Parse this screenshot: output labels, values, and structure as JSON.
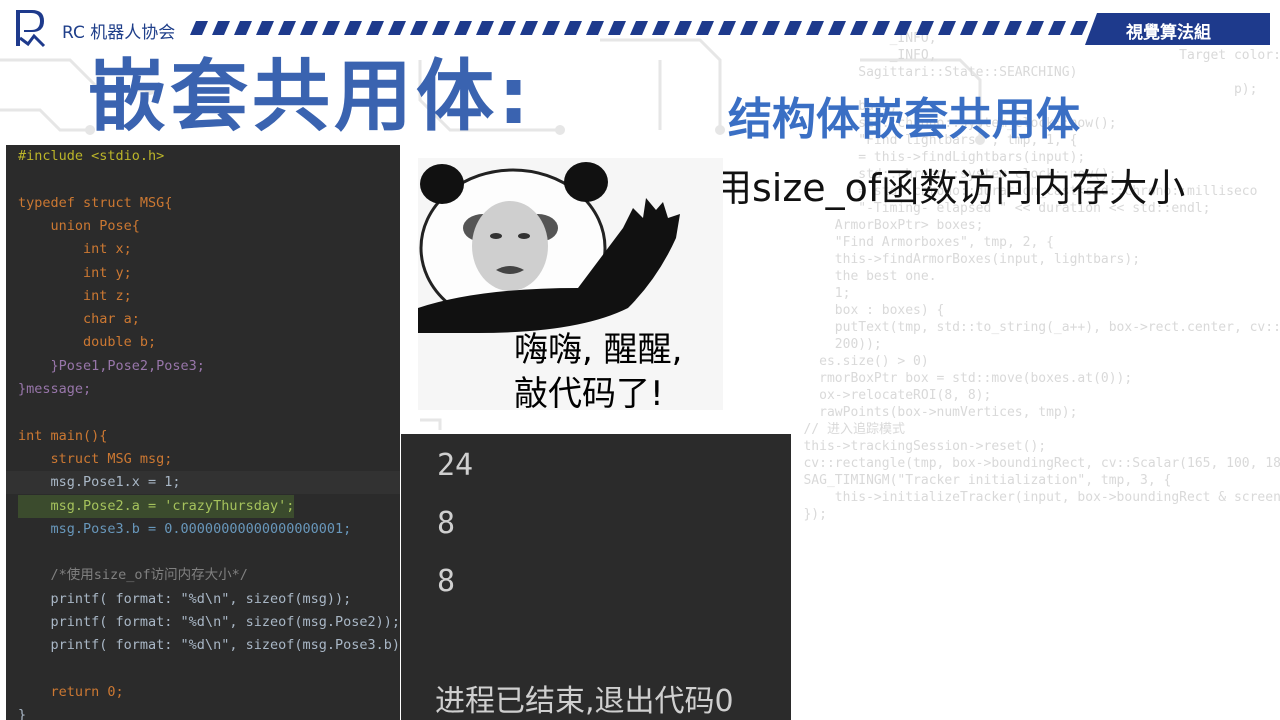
{
  "header": {
    "org_name": "RC 机器人协会",
    "team_label": "視覺算法組",
    "logo_icon": "rc-logo-icon",
    "accent": "#1e3a8c"
  },
  "slide": {
    "title": "嵌套共用体:",
    "subtitle": "结构体嵌套共用体",
    "description": "使用size_of函数访问内存大小"
  },
  "code": {
    "lines": [
      "#include <stdio.h>",
      "",
      "typedef struct MSG{",
      "    union Pose{",
      "        int x;",
      "        int y;",
      "        int z;",
      "        char a;",
      "        double b;",
      "    }Pose1,Pose2,Pose3;",
      "}message;",
      "",
      "int main(){",
      "    struct MSG msg;",
      "    msg.Pose1.x = 1;",
      "    msg.Pose2.a = 'crazyThursday';",
      "    msg.Pose3.b = 0.00000000000000000001;",
      "",
      "    /*使用size_of访问内存大小*/",
      "    printf( format: \"%d\\n\", sizeof(msg));",
      "    printf( format: \"%d\\n\", sizeof(msg.Pose2));",
      "    printf( format: \"%d\\n\", sizeof(msg.Pose3.b));",
      "",
      "    return 0;",
      "}"
    ]
  },
  "meme": {
    "line1": "嗨嗨, 醒醒,",
    "line2": "敲代码了!"
  },
  "output": {
    "values": [
      "24",
      "8",
      "8"
    ],
    "exit_message": "进程已结束,退出代码0"
  },
  "background_code": [
    "              _INFO,",
    "",
    "              _INFO,                               Target color:",
    "",
    "",
    "",
    "",
    "          Sagittari::State::SEARCHING)",
    "",
    "                                                          p);",
    "          bars;",
    "          std::chrono::system_clock::now();",
    "          \"Find lightbars \", tmp, 1, {",
    "          = this->findLightbars(input);",
    "",
    "          std::chrono::system_clock::now();",
    "          = std::chrono::duration_cast<std::chrono::milliseco",
    "          \"-Timing- elapsed \" << duration << std::endl;",
    "       ArmorBoxPtr> boxes;",
    "       \"Find Armorboxes\", tmp, 2, {",
    "       this->findArmorBoxes(input, lightbars);",
    "",
    "",
    "       the best one.",
    "       1;",
    "       box : boxes) {",
    "       putText(tmp, std::to_string(_a++), box->rect.center, cv::",
    "       200));",
    "",
    "     es.size() > 0)",
    "",
    "     rmorBoxPtr box = std::move(boxes.at(0));",
    "     ox->relocateROI(8, 8);",
    "     rawPoints(box->numVertices, tmp);",
    "",
    "   // 进入追踪模式",
    "   this->trackingSession->reset();",
    "   cv::rectangle(tmp, box->boundingRect, cv::Scalar(165, 100, 18",
    "   SAG_TIMINGM(\"Tracker initialization\", tmp, 3, {",
    "       this->initializeTracker(input, box->boundingRect & screen",
    "   });"
  ]
}
